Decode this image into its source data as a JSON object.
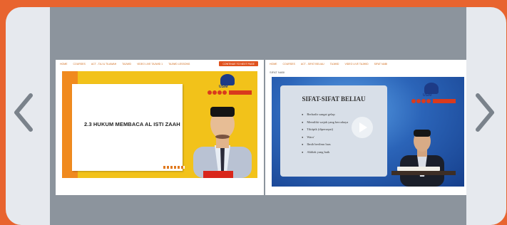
{
  "carousel": {
    "prev_icon": "chevron-left-icon",
    "next_icon": "chevron-right-icon",
    "frame_color": "#e6e9ee",
    "background_color": "#e8642f"
  },
  "page1": {
    "nav": [
      "HOME",
      "COURSES",
      "ACT - TAJ & TILAWAH",
      "TAJWID",
      "VIDEO LIVE TAJWID 1",
      "TAJWID LESSONS"
    ],
    "action_button": "CONTINUE TO NEXT PAGE",
    "video": {
      "slide_title": "2.3  HUKUM MEMBACA AL ISTI ZAAH",
      "logo_text": "USIM"
    }
  },
  "page2": {
    "nav": [
      "HOME",
      "COURSES",
      "ACT - SIFAT BELIAU",
      "TAJWID",
      "VIDEO LIVE TAJWID",
      "SIFAT NABI"
    ],
    "title": "SIFAT NABI",
    "video": {
      "slide_title": "SIFAT-SIFAT BELIAU",
      "bullets": [
        "Berhadir sangat gelap",
        "Memiliki wajah yang bercahaya",
        "Tiktipik (dipersepsi)",
        "Wara'",
        "Ilmih berilmu luas",
        "Akhlak yang baik"
      ],
      "logo_text": "USIM",
      "play_icon": "play-icon"
    }
  }
}
